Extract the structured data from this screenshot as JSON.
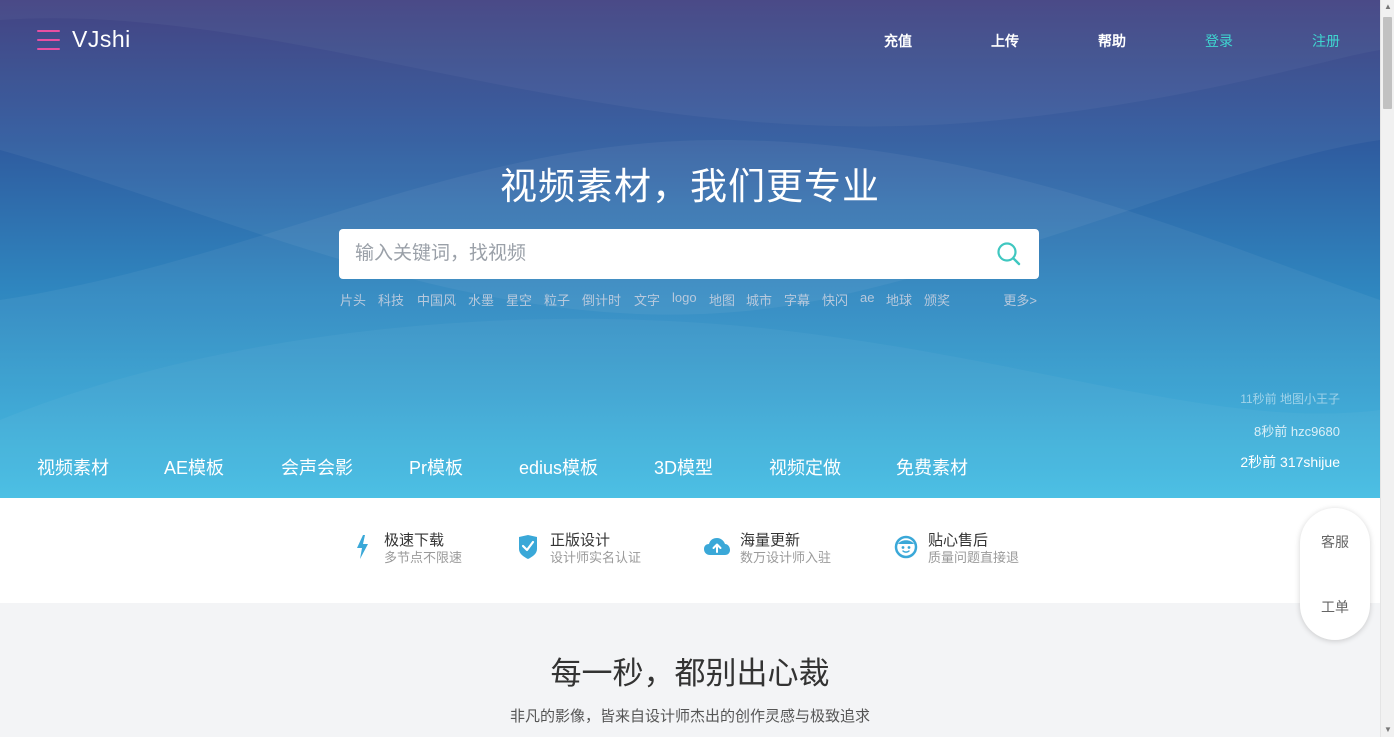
{
  "brand": {
    "name": "VJshi",
    "accent_color": "#e84fa2"
  },
  "topnav": {
    "items": [
      {
        "label": "充值"
      },
      {
        "label": "上传"
      },
      {
        "label": "帮助"
      },
      {
        "label": "登录"
      },
      {
        "label": "注册"
      }
    ],
    "accent_color": "#3fd6d0"
  },
  "hero": {
    "headline": "视频素材，我们更专业",
    "search_placeholder": "输入关键词，找视频",
    "hotwords": [
      "片头",
      "科技",
      "中国风",
      "水墨",
      "星空",
      "粒子",
      "倒计时",
      "文字",
      "logo",
      "地图",
      "城市",
      "字幕",
      "快闪",
      "ae",
      "地球",
      "颁奖"
    ],
    "more_label": "更多>"
  },
  "activity": [
    {
      "text": "11秒前 地图小王子"
    },
    {
      "text": "8秒前 hzc9680"
    },
    {
      "text": "2秒前 317shijue"
    }
  ],
  "categories": [
    "视频素材",
    "AE模板",
    "会声会影",
    "Pr模板",
    "edius模板",
    "3D模型",
    "视频定做",
    "免费素材"
  ],
  "features": [
    {
      "icon": "lightning-icon",
      "title": "极速下载",
      "subtitle": "多节点不限速"
    },
    {
      "icon": "shield-check-icon",
      "title": "正版设计",
      "subtitle": "设计师实名认证"
    },
    {
      "icon": "cloud-upload-icon",
      "title": "海量更新",
      "subtitle": "数万设计师入驻"
    },
    {
      "icon": "smile-face-icon",
      "title": "贴心售后",
      "subtitle": "质量问题直接退"
    }
  ],
  "feature_icon_color": "#3aa8d8",
  "section": {
    "title": "每一秒，都别出心裁",
    "subtitle": "非凡的影像，皆来自设计师杰出的创作灵感与极致追求"
  },
  "float_service": {
    "service_label": "客服",
    "ticket_label": "工单"
  }
}
